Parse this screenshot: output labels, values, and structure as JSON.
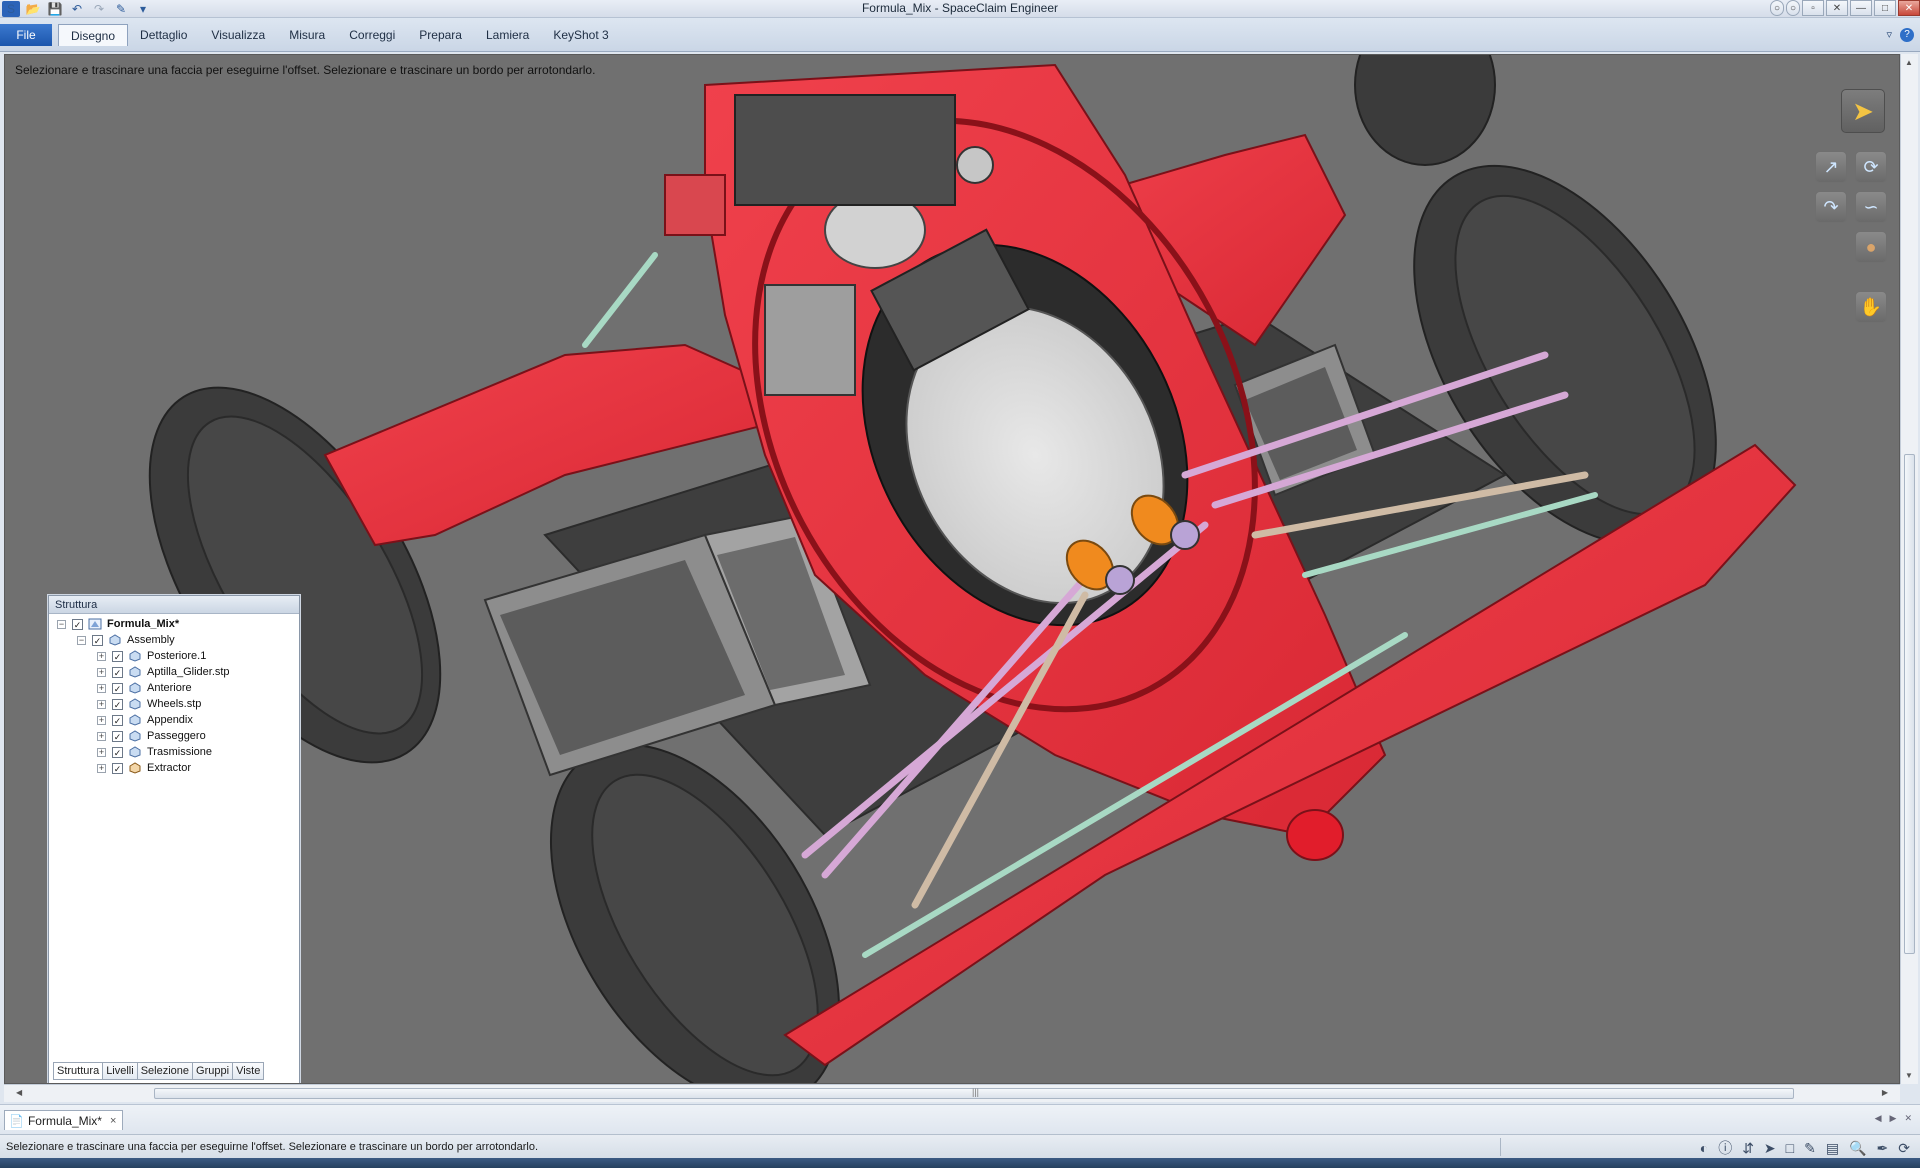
{
  "app": {
    "title": "Formula_Mix - SpaceClaim Engineer"
  },
  "quick_access": {
    "icons": [
      "app-icon",
      "open-icon",
      "save-icon",
      "undo-icon",
      "redo-icon",
      "brush-icon",
      "customize-icon"
    ]
  },
  "ribbon": {
    "file_label": "File",
    "tabs": [
      {
        "label": "Disegno",
        "active": true
      },
      {
        "label": "Dettaglio"
      },
      {
        "label": "Visualizza"
      },
      {
        "label": "Misura"
      },
      {
        "label": "Correggi"
      },
      {
        "label": "Prepara"
      },
      {
        "label": "Lamiera"
      },
      {
        "label": "KeyShot 3"
      }
    ]
  },
  "viewport": {
    "hint": "Selezionare e trascinare una faccia per eseguirne l'offset. Selezionare e trascinare un bordo per arrotondarlo.",
    "background_color": "#707070",
    "body_color": "#e8323f"
  },
  "structure_panel": {
    "title": "Struttura",
    "root": {
      "label": "Formula_Mix*",
      "checked": true
    },
    "assembly": {
      "label": "Assembly",
      "checked": true
    },
    "children": [
      {
        "label": "Posteriore.1",
        "checked": true
      },
      {
        "label": "Aptilla_Glider.stp",
        "checked": true
      },
      {
        "label": "Anteriore",
        "checked": true
      },
      {
        "label": "Wheels.stp",
        "checked": true
      },
      {
        "label": "Appendix",
        "checked": true
      },
      {
        "label": "Passeggero",
        "checked": true
      },
      {
        "label": "Trasmissione",
        "checked": true
      },
      {
        "label": "Extractor",
        "checked": true
      }
    ],
    "tabs": [
      "Struttura",
      "Livelli",
      "Selezione",
      "Gruppi",
      "Viste"
    ]
  },
  "document_tab": {
    "label": "Formula_Mix*",
    "close": "×"
  },
  "status_bar": {
    "message": "Selezionare e trascinare una faccia per eseguirne l'offset. Selezionare e trascinare un bordo per arrotondarlo."
  }
}
